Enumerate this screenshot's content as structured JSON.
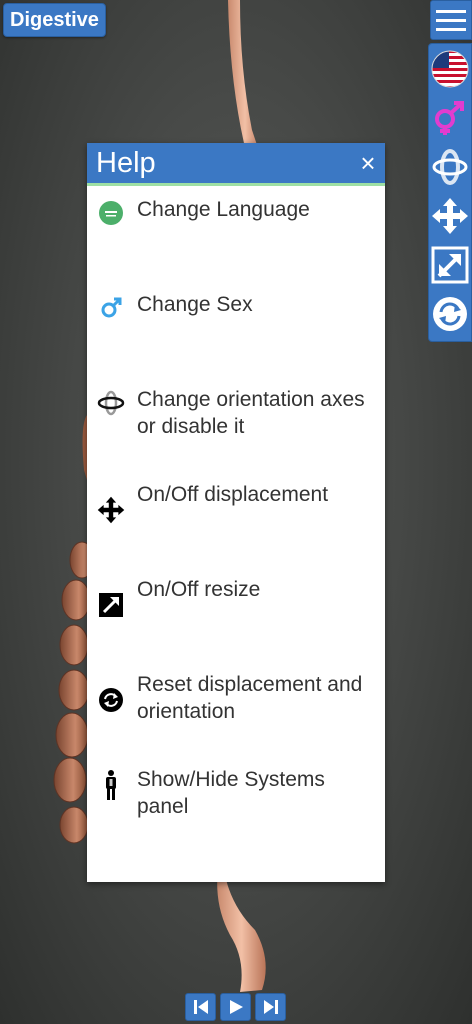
{
  "system_label": "Digestive",
  "help": {
    "title": "Help",
    "close_glyph": "×",
    "items": [
      {
        "icon": "language-flag-icon",
        "text": "Change Language"
      },
      {
        "icon": "male-symbol-icon",
        "text": "Change Sex"
      },
      {
        "icon": "orientation-axes-icon",
        "text": "Change orientation axes or disable it"
      },
      {
        "icon": "move-arrows-icon",
        "text": "On/Off displacement"
      },
      {
        "icon": "resize-arrow-icon",
        "text": "On/Off resize"
      },
      {
        "icon": "reset-icon",
        "text": "Reset displacement and orientation"
      },
      {
        "icon": "human-figure-icon",
        "text": "Show/Hide Systems panel"
      }
    ]
  },
  "toolbar": {
    "items": [
      "us-flag-icon",
      "sex-toggle-icon",
      "rotate-axes-icon",
      "move-icon",
      "resize-icon",
      "reset-icon"
    ]
  },
  "playback": [
    "skip-back-icon",
    "play-icon",
    "skip-forward-icon"
  ],
  "colors": {
    "accent": "#3b78c4",
    "help_divider": "#9ee0a4",
    "sex_icon_pink": "#e23ccf",
    "male_icon_blue": "#3ba3e6"
  }
}
